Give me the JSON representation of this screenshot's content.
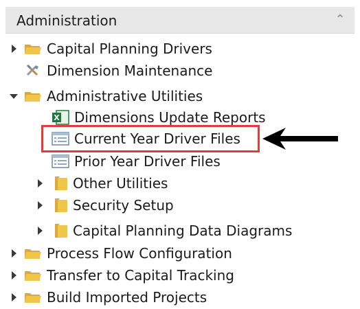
{
  "panel": {
    "title": "Administration",
    "collapse_icon": "chevron-up-icon"
  },
  "tree": [
    {
      "label": "Capital Planning Drivers",
      "icon": "open-folder-icon",
      "expanded": false
    },
    {
      "label": "Dimension Maintenance",
      "icon": "tools-icon",
      "expanded": null
    },
    {
      "label": "Administrative Utilities",
      "icon": "open-folder-icon",
      "expanded": true
    },
    {
      "label": "Dimensions Update Reports",
      "icon": "excel-icon",
      "expanded": null
    },
    {
      "label": "Current Year Driver Files",
      "icon": "form-icon",
      "expanded": null,
      "highlighted": true
    },
    {
      "label": "Prior Year Driver Files",
      "icon": "form-icon",
      "expanded": null
    },
    {
      "label": "Other Utilities",
      "icon": "closed-folder-icon",
      "expanded": false
    },
    {
      "label": "Security Setup",
      "icon": "closed-folder-icon",
      "expanded": false
    },
    {
      "label": "Capital Planning Data Diagrams",
      "icon": "closed-folder-icon",
      "expanded": false
    },
    {
      "label": "Process Flow Configuration",
      "icon": "open-folder-icon",
      "expanded": false
    },
    {
      "label": "Transfer to Capital Tracking",
      "icon": "open-folder-icon",
      "expanded": false
    },
    {
      "label": "Build Imported Projects",
      "icon": "open-folder-icon",
      "expanded": false
    }
  ],
  "colors": {
    "highlight_border": "#e23b3b",
    "folder": "#f0c64a",
    "header_bg": "#e8e8e8",
    "excel_green": "#1f7a3a"
  },
  "annotation": {
    "pointer_icon": "left-arrow-icon"
  }
}
